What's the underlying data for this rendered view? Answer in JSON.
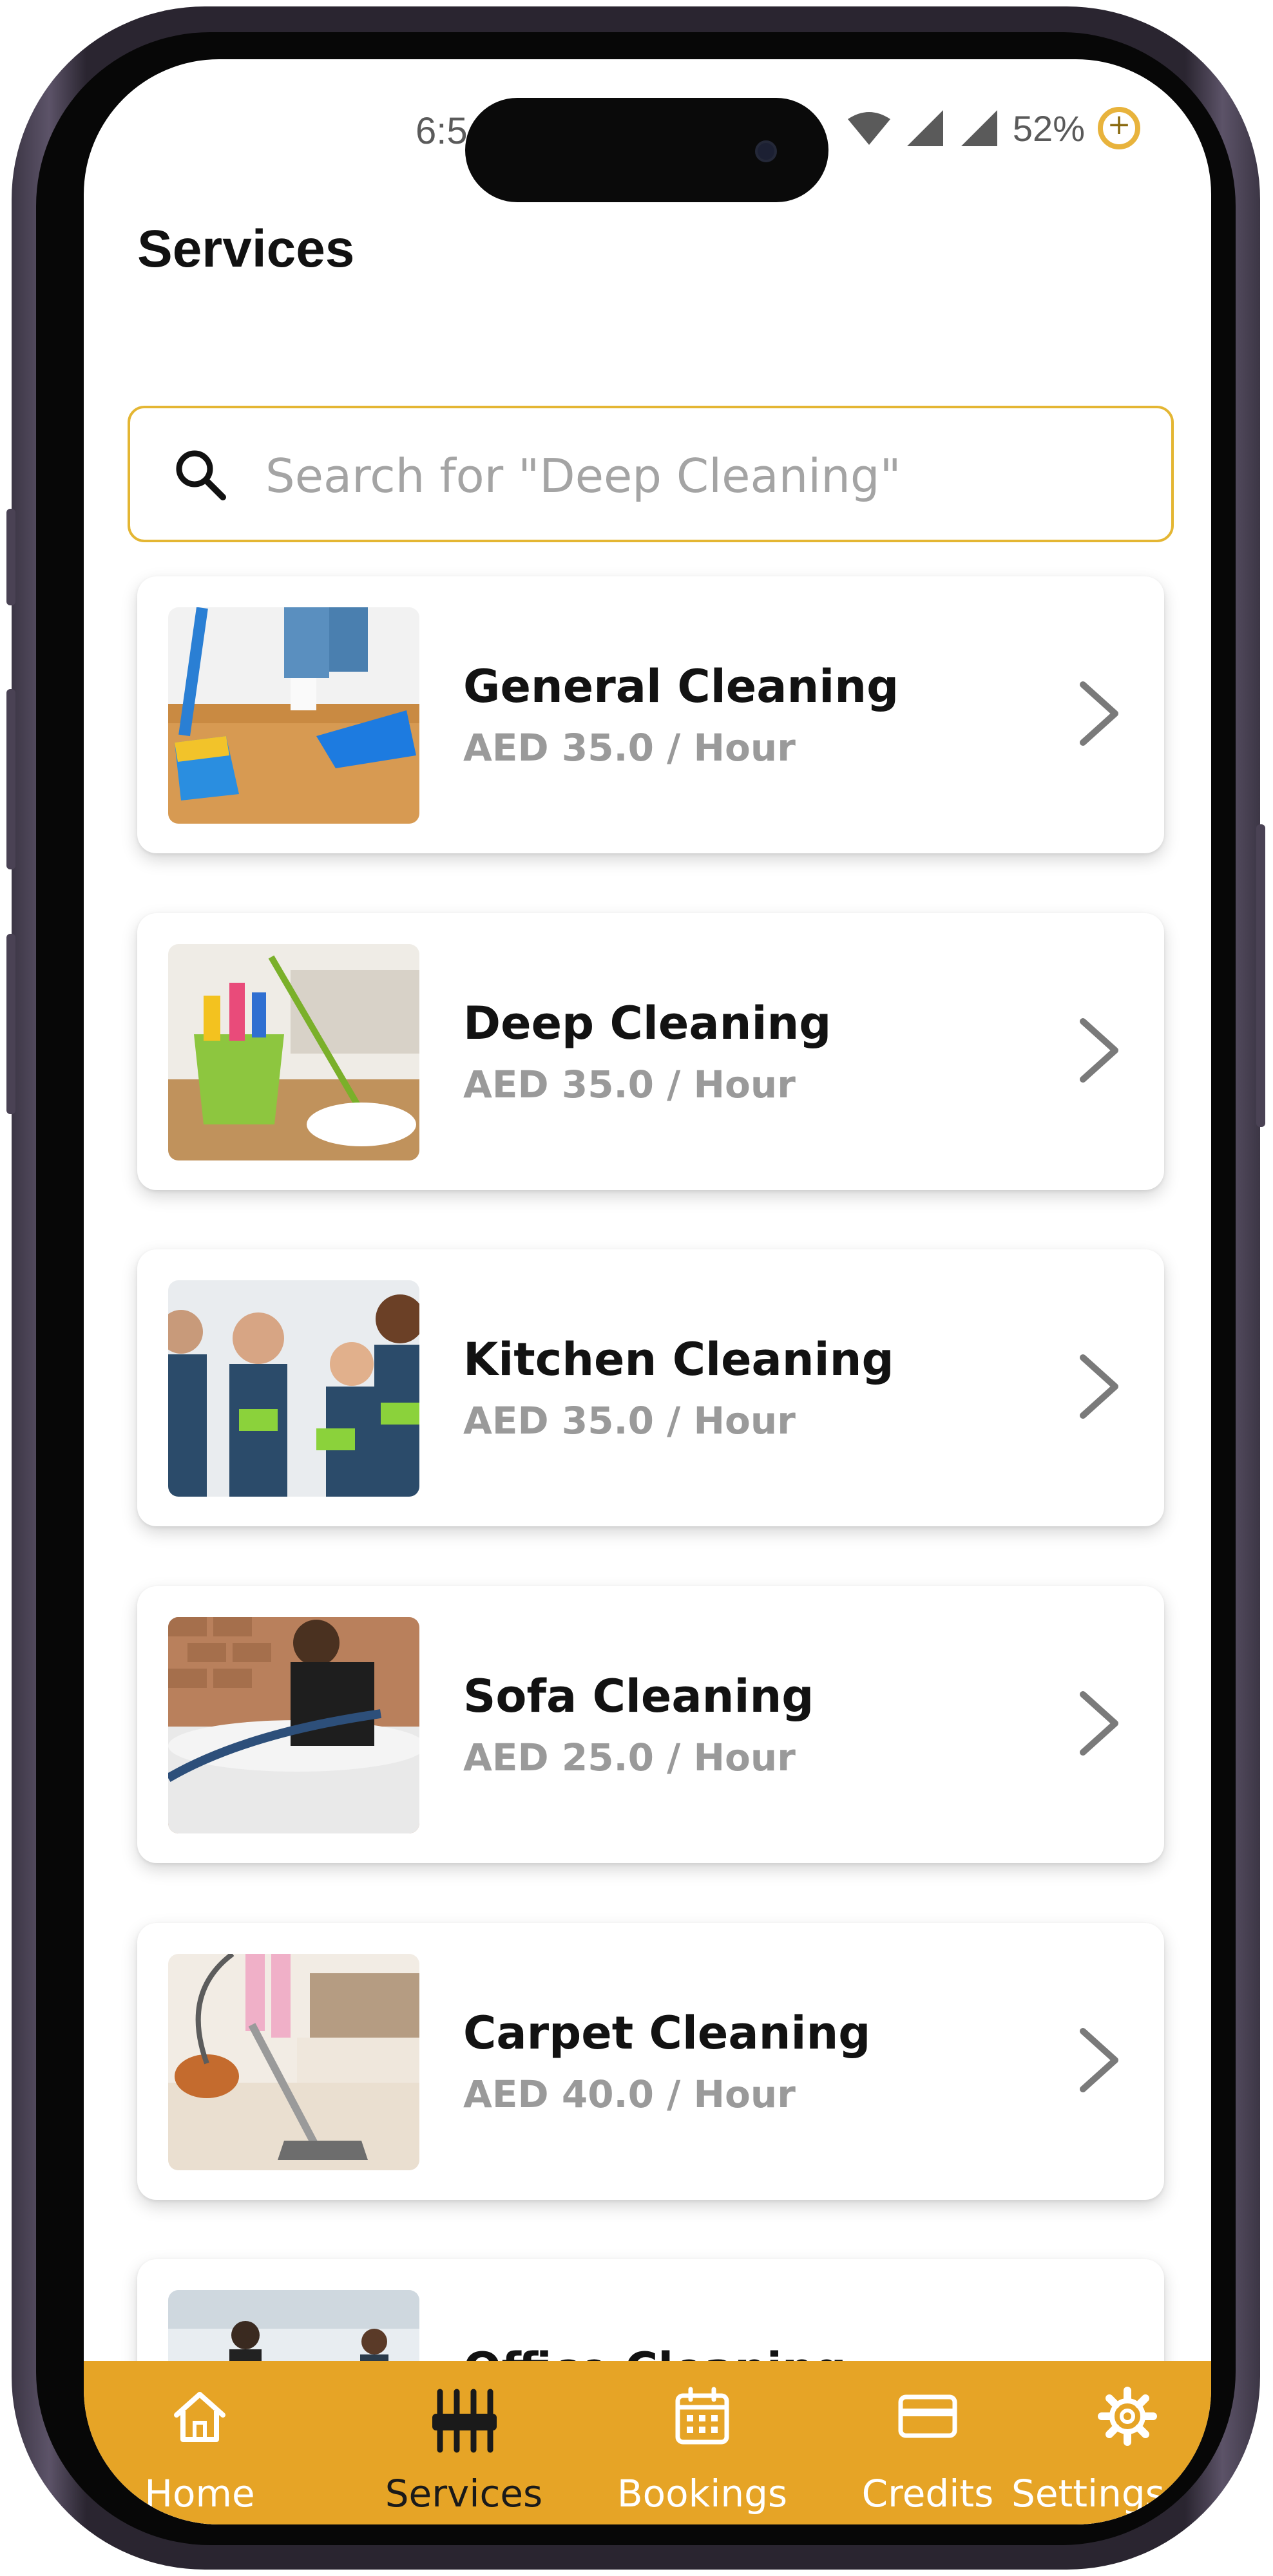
{
  "status_bar": {
    "time": "6:5",
    "battery": "52%"
  },
  "page": {
    "title": "Services"
  },
  "search": {
    "placeholder": "Search for \"Deep Cleaning\""
  },
  "services": [
    {
      "name": "General Cleaning",
      "price": "AED 35.0 / Hour"
    },
    {
      "name": "Deep Cleaning",
      "price": "AED 35.0 / Hour"
    },
    {
      "name": "Kitchen Cleaning",
      "price": "AED 35.0 / Hour"
    },
    {
      "name": "Sofa Cleaning",
      "price": "AED 25.0 / Hour"
    },
    {
      "name": "Carpet Cleaning",
      "price": "AED 40.0 / Hour"
    },
    {
      "name": "Office Cleaning",
      "price": ""
    }
  ],
  "nav": {
    "items": [
      {
        "label": "Home",
        "icon": "home-icon"
      },
      {
        "label": "Services",
        "icon": "services-icon"
      },
      {
        "label": "Bookings",
        "icon": "calendar-icon"
      },
      {
        "label": "Credits",
        "icon": "credit-card-icon"
      },
      {
        "label": "Settings",
        "icon": "gear-icon"
      }
    ],
    "active": "Services"
  },
  "colors": {
    "accent": "#e6a426",
    "search_border": "#e4b633",
    "title": "#111111",
    "price": "#9a9a9a"
  }
}
